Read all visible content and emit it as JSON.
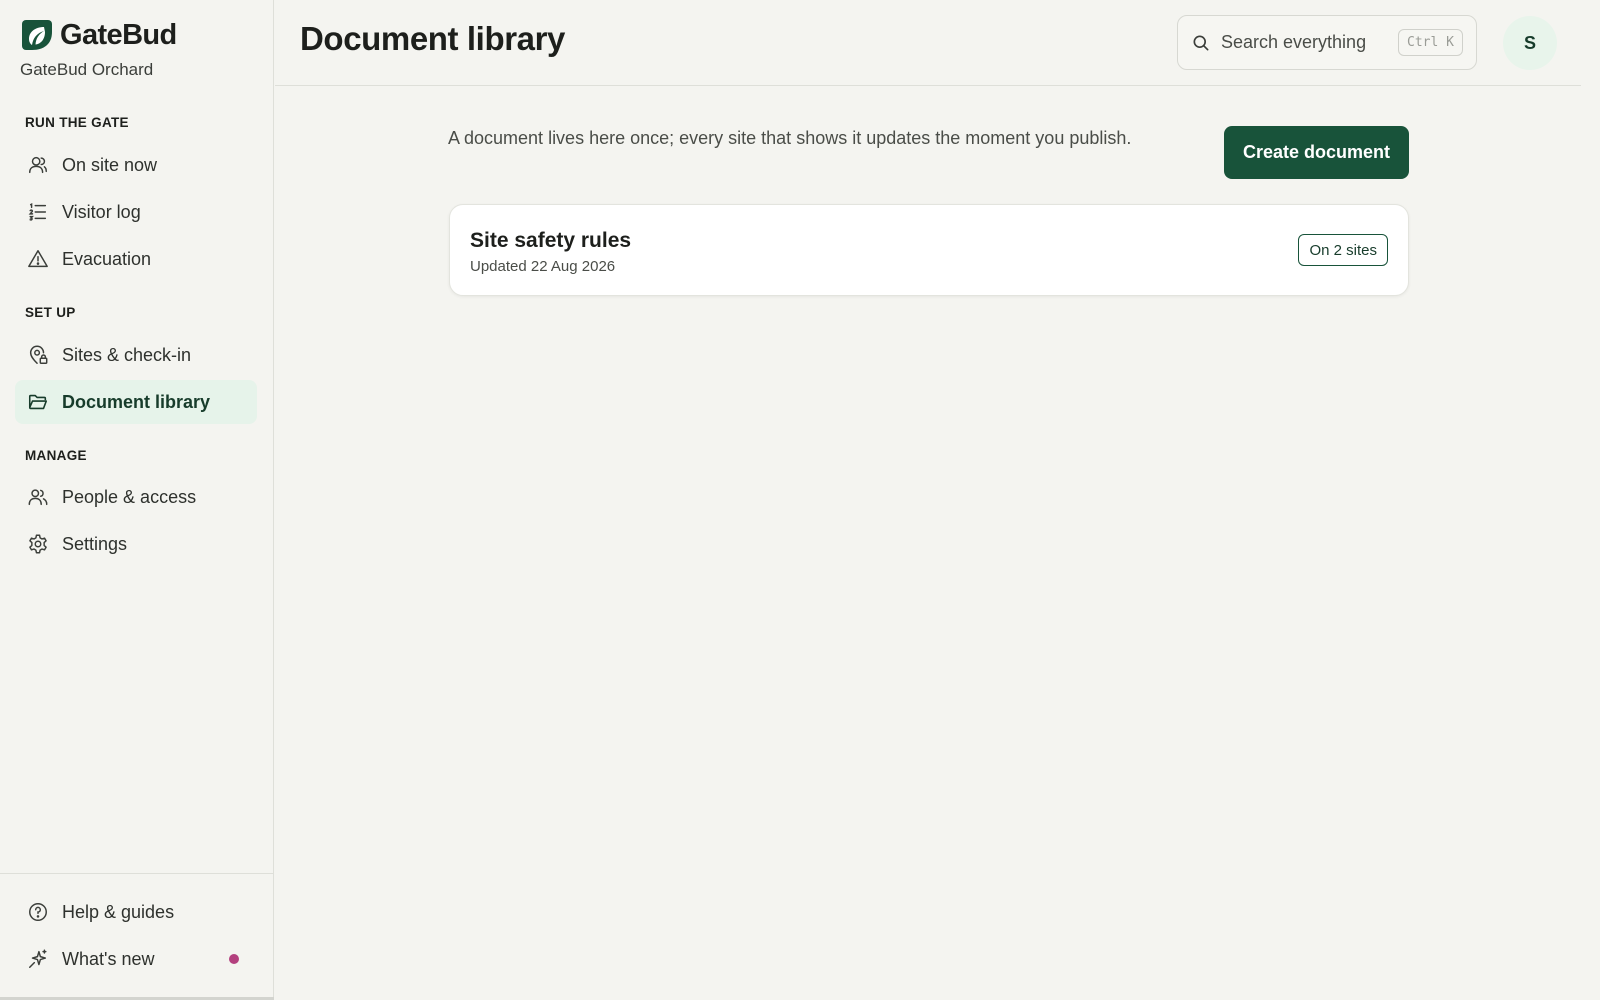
{
  "brand": {
    "name": "GateBud",
    "org": "GateBud Orchard",
    "accent": "#18533a"
  },
  "sidebar": {
    "sections": [
      {
        "label": "RUN THE GATE"
      },
      {
        "label": "SET UP"
      },
      {
        "label": "MANAGE"
      }
    ],
    "items": [
      {
        "label": "On site now",
        "icon": "person-icon"
      },
      {
        "label": "Visitor log",
        "icon": "list-icon"
      },
      {
        "label": "Evacuation",
        "icon": "warning-icon"
      },
      {
        "label": "Sites & check-in",
        "icon": "location-lock-icon"
      },
      {
        "label": "Document library",
        "icon": "folder-icon",
        "active": true
      },
      {
        "label": "People & access",
        "icon": "people-icon"
      },
      {
        "label": "Settings",
        "icon": "gear-icon"
      }
    ],
    "bottom": [
      {
        "label": "Help & guides",
        "icon": "help-icon"
      },
      {
        "label": "What's new",
        "icon": "sparkle-icon",
        "has_dot": true
      }
    ]
  },
  "header": {
    "title": "Document library",
    "search": {
      "placeholder": "Search everything",
      "shortcut": "Ctrl K"
    },
    "avatar_initial": "S"
  },
  "main": {
    "intro": "A document lives here once; every site that shows it updates the moment you publish.",
    "create_label": "Create document",
    "documents": [
      {
        "title": "Site safety rules",
        "updated": "Updated 22 Aug 2026",
        "badge": "On 2 sites"
      }
    ]
  }
}
